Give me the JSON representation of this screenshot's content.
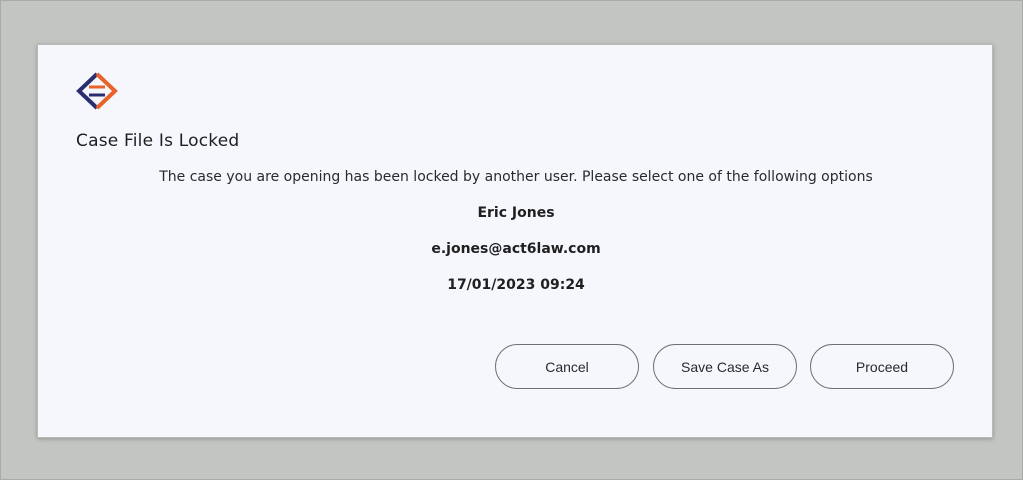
{
  "dialog": {
    "title": "Case File Is Locked",
    "message": "The case you are opening has been locked by another user. Please select one of the following options",
    "lock_user_name": "Eric Jones",
    "lock_user_email": "e.jones@act6law.com",
    "lock_timestamp": "17/01/2023 09:24",
    "logo_icon": "act6-logo-icon"
  },
  "buttons": {
    "cancel_label": "Cancel",
    "save_as_label": "Save Case As",
    "proceed_label": "Proceed"
  },
  "colors": {
    "logo_navy": "#2b2e6e",
    "logo_orange": "#e8622a",
    "dialog_background": "#f6f7fd",
    "backdrop": "#c3c5c2"
  }
}
